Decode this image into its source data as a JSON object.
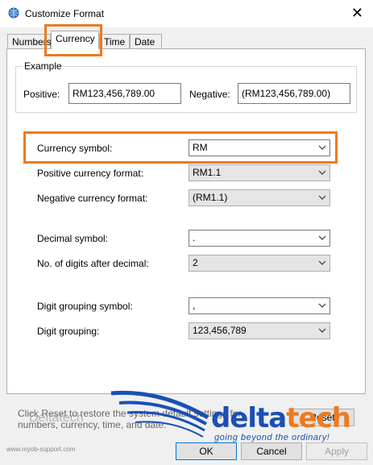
{
  "window": {
    "title": "Customize Format",
    "icon": "globe-gear-icon",
    "close_glyph": "✕"
  },
  "tabs": [
    {
      "label": "Numbers",
      "active": false
    },
    {
      "label": "Currency",
      "active": true
    },
    {
      "label": "Time",
      "active": false
    },
    {
      "label": "Date",
      "active": false
    }
  ],
  "example": {
    "legend": "Example",
    "positive_label": "Positive:",
    "positive_value": "RM123,456,789.00",
    "negative_label": "Negative:",
    "negative_value": "(RM123,456,789.00)"
  },
  "fields": [
    {
      "label": "Currency symbol:",
      "value": "RM"
    },
    {
      "label": "Positive currency format:",
      "value": "RM1.1"
    },
    {
      "label": "Negative currency format:",
      "value": "(RM1.1)"
    },
    {
      "label": "Decimal symbol:",
      "value": "."
    },
    {
      "label": "No. of digits after decimal:",
      "value": "2"
    },
    {
      "label": "Digit grouping symbol:",
      "value": ","
    },
    {
      "label": "Digit grouping:",
      "value": "123,456,789"
    }
  ],
  "footer": {
    "note": "Click Reset to restore the system default settings for numbers, currency, time, and date.",
    "reset_label": "Reset"
  },
  "buttons": {
    "ok": "OK",
    "cancel": "Cancel",
    "apply": "Apply"
  },
  "overlay": {
    "site": "www.myob-support.com",
    "ghost_text": "Deltatech",
    "logo_main": "delta",
    "logo_accent": "tech",
    "tagline": "going beyond the ordinary!"
  },
  "colors": {
    "highlight": "#ee7a1f",
    "logo_blue": "#1a4fb4"
  }
}
